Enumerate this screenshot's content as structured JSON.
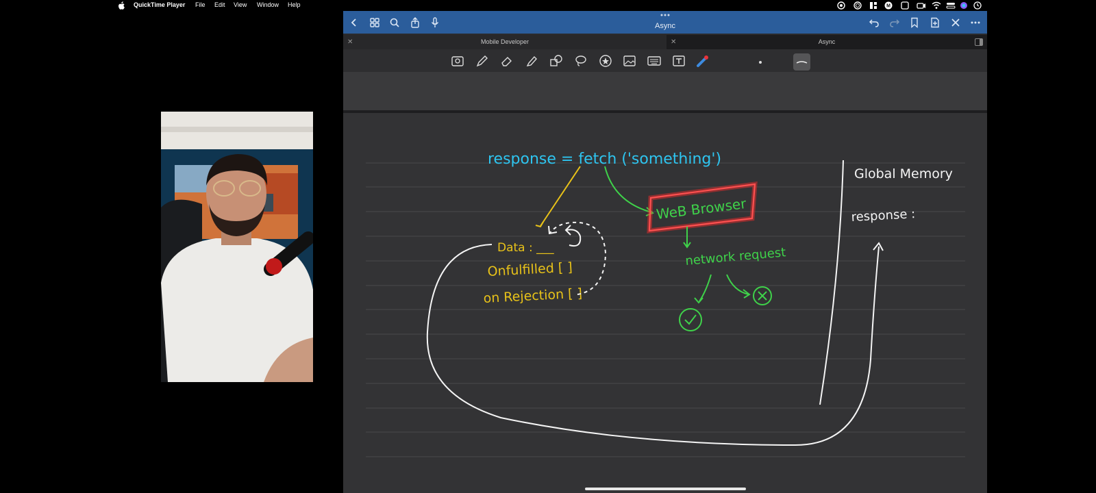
{
  "menubar": {
    "app_name": "QuickTime Player",
    "items": [
      "File",
      "Edit",
      "View",
      "Window",
      "Help"
    ]
  },
  "webcam": {
    "description_icon": "presenter-video"
  },
  "app": {
    "document_title": "Async",
    "tabs": [
      {
        "label": "Mobile Developer"
      },
      {
        "label": "Async"
      }
    ],
    "colors": {
      "title_bar": "#2b5d9b",
      "ink_cyan": "#2ec5f0",
      "ink_yellow": "#e8c219",
      "ink_green": "#3fd24a",
      "ink_white": "#ffffff",
      "highlight_red": "#ff2a2a"
    }
  },
  "notes": {
    "line1": "response = fetch ('something')",
    "data_label": "Data : ___",
    "onfulfilled": "Onfulfilled [ ]",
    "onrejection": "on Rejection [ ]",
    "web_browser": "WeB Browser",
    "network_request": "network request",
    "global_memory": "Global Memory",
    "response_label": "response :"
  }
}
